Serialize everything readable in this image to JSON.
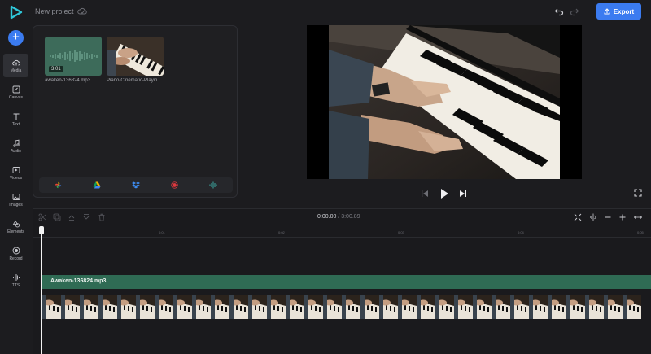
{
  "header": {
    "project_title": "New project",
    "export_label": "Export"
  },
  "sidebar": {
    "add_label": "+",
    "items": [
      {
        "label": "Media",
        "icon": "cloud-upload-icon"
      },
      {
        "label": "Canvas",
        "icon": "canvas-icon"
      },
      {
        "label": "Text",
        "icon": "text-icon"
      },
      {
        "label": "Audio",
        "icon": "music-note-icon"
      },
      {
        "label": "Videos",
        "icon": "video-icon"
      },
      {
        "label": "Images",
        "icon": "image-icon"
      },
      {
        "label": "Elements",
        "icon": "shapes-icon"
      },
      {
        "label": "Record",
        "icon": "record-icon"
      },
      {
        "label": "TTS",
        "icon": "waveform-icon"
      }
    ]
  },
  "media": {
    "audio_duration": "3:01",
    "audio_filename": "awaken-136824.mp3",
    "video_filename": "Piano-Cinematic-Playin..."
  },
  "import_sources": [
    "google-photos-icon",
    "google-drive-icon",
    "dropbox-icon",
    "record-icon",
    "audio-wave-icon"
  ],
  "timeline": {
    "current_time": "0:00.00",
    "separator": "/",
    "total_time": "3:00.89",
    "ruler_ticks": [
      "0",
      "0:01",
      "0:02",
      "0:03",
      "0:04",
      "0:05"
    ],
    "audio_clip_label": "Awaken-136824.mp3"
  },
  "colors": {
    "accent": "#3b7bf0",
    "audio_track": "#2f6b54",
    "background": "#1c1c1f"
  }
}
